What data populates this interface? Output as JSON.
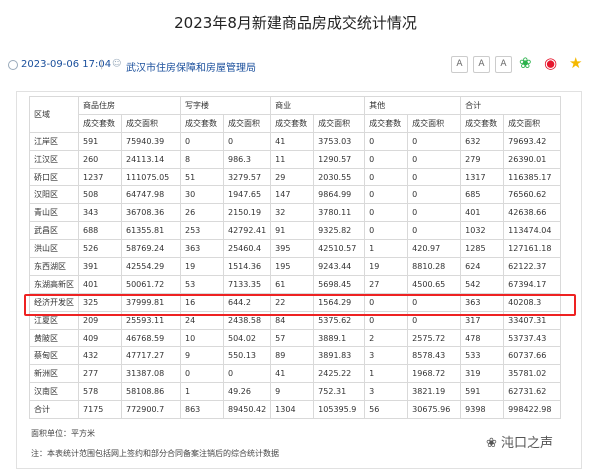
{
  "article": {
    "title": "2023年8月新建商品房成交统计情况",
    "date": "2023-09-06 17:04",
    "separator": "|",
    "source": "武汉市住房保障和房屋管理局",
    "font_buttons": [
      "A",
      "A",
      "A"
    ]
  },
  "share_icons": [
    "wechat-icon",
    "weibo-icon",
    "favorite-icon"
  ],
  "table": {
    "col_district": "区域",
    "groups": [
      "商品住房",
      "写字楼",
      "商业",
      "其他",
      "合计"
    ],
    "sub_headers": [
      "成交套数",
      "成交面积"
    ],
    "rows": [
      [
        "江岸区",
        "591",
        "75940.39",
        "0",
        "0",
        "41",
        "3753.03",
        "0",
        "0",
        "632",
        "79693.42"
      ],
      [
        "江汉区",
        "260",
        "24113.14",
        "8",
        "986.3",
        "11",
        "1290.57",
        "0",
        "0",
        "279",
        "26390.01"
      ],
      [
        "硚口区",
        "1237",
        "111075.05",
        "51",
        "3279.57",
        "29",
        "2030.55",
        "0",
        "0",
        "1317",
        "116385.17"
      ],
      [
        "汉阳区",
        "508",
        "64747.98",
        "30",
        "1947.65",
        "147",
        "9864.99",
        "0",
        "0",
        "685",
        "76560.62"
      ],
      [
        "青山区",
        "343",
        "36708.36",
        "26",
        "2150.19",
        "32",
        "3780.11",
        "0",
        "0",
        "401",
        "42638.66"
      ],
      [
        "武昌区",
        "688",
        "61355.81",
        "253",
        "42792.41",
        "91",
        "9325.82",
        "0",
        "0",
        "1032",
        "113474.04"
      ],
      [
        "洪山区",
        "526",
        "58769.24",
        "363",
        "25460.4",
        "395",
        "42510.57",
        "1",
        "420.97",
        "1285",
        "127161.18"
      ],
      [
        "东西湖区",
        "391",
        "42554.29",
        "19",
        "1514.36",
        "195",
        "9243.44",
        "19",
        "8810.28",
        "624",
        "62122.37"
      ],
      [
        "东湖高新区",
        "401",
        "50061.72",
        "53",
        "7133.35",
        "61",
        "5698.45",
        "27",
        "4500.65",
        "542",
        "67394.17"
      ],
      [
        "经济开发区",
        "325",
        "37999.81",
        "16",
        "644.2",
        "22",
        "1564.29",
        "0",
        "0",
        "363",
        "40208.3"
      ],
      [
        "江夏区",
        "209",
        "25593.11",
        "24",
        "2438.58",
        "84",
        "5375.62",
        "0",
        "0",
        "317",
        "33407.31"
      ],
      [
        "黄陂区",
        "409",
        "46768.59",
        "10",
        "504.02",
        "57",
        "3889.1",
        "2",
        "2575.72",
        "478",
        "53737.43"
      ],
      [
        "蔡甸区",
        "432",
        "47717.27",
        "9",
        "550.13",
        "89",
        "3891.83",
        "3",
        "8578.43",
        "533",
        "60737.66"
      ],
      [
        "新洲区",
        "277",
        "31387.08",
        "0",
        "0",
        "41",
        "2425.22",
        "1",
        "1968.72",
        "319",
        "35781.02"
      ],
      [
        "汉南区",
        "578",
        "58108.86",
        "1",
        "49.26",
        "9",
        "752.31",
        "3",
        "3821.19",
        "591",
        "62731.62"
      ],
      [
        "合计",
        "7175",
        "772900.7",
        "863",
        "89450.42",
        "1304",
        "105395.9",
        "56",
        "30675.96",
        "9398",
        "998422.98"
      ]
    ]
  },
  "notes": {
    "unit": "面积单位：平方米",
    "remark": "注：本表统计范围包括网上签约和部分合同备案注销后的综合统计数据"
  },
  "watermark": "沌口之声",
  "colors": {
    "highlight": "#e22222",
    "source_link": "#1a4f9c",
    "border": "#d9d9d9"
  }
}
